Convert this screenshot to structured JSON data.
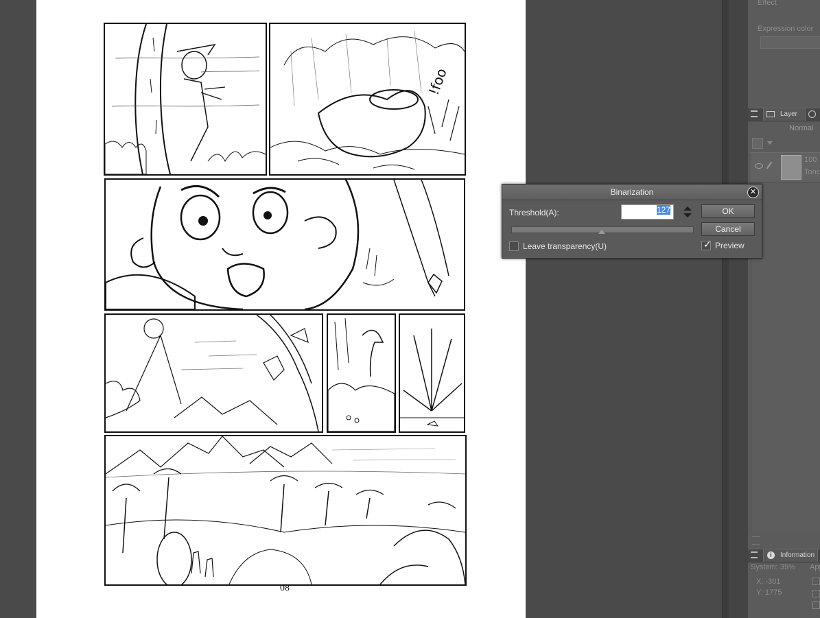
{
  "canvas": {
    "page_number": "08",
    "panels": [
      {
        "id": "panel-1"
      },
      {
        "id": "panel-2"
      },
      {
        "id": "panel-3"
      },
      {
        "id": "panel-4"
      },
      {
        "id": "panel-5"
      },
      {
        "id": "panel-6"
      },
      {
        "id": "panel-7"
      }
    ],
    "sfx_text": "!foo"
  },
  "right_panel": {
    "effect_label": "Effect",
    "expression_color_label": "Expression color",
    "layer_tab_label": "Layer",
    "blend_mode": "Normal",
    "layer_name_partial": "100",
    "layer_sub_partial": "Tonc",
    "info_tab_label": "Information",
    "system_label": "System: 35%",
    "applied_label": "Appli",
    "x_label": "X: -301",
    "y_label": "Y: 1775"
  },
  "dialog": {
    "title": "Binarization",
    "threshold_label": "Threshold(A):",
    "threshold_value": "127",
    "threshold_max": 255,
    "ok_label": "OK",
    "cancel_label": "Cancel",
    "leave_transparency_label": "Leave transparency(U)",
    "leave_transparency_checked": false,
    "preview_label": "Preview",
    "preview_checked": true,
    "close_icon": "close-icon"
  }
}
